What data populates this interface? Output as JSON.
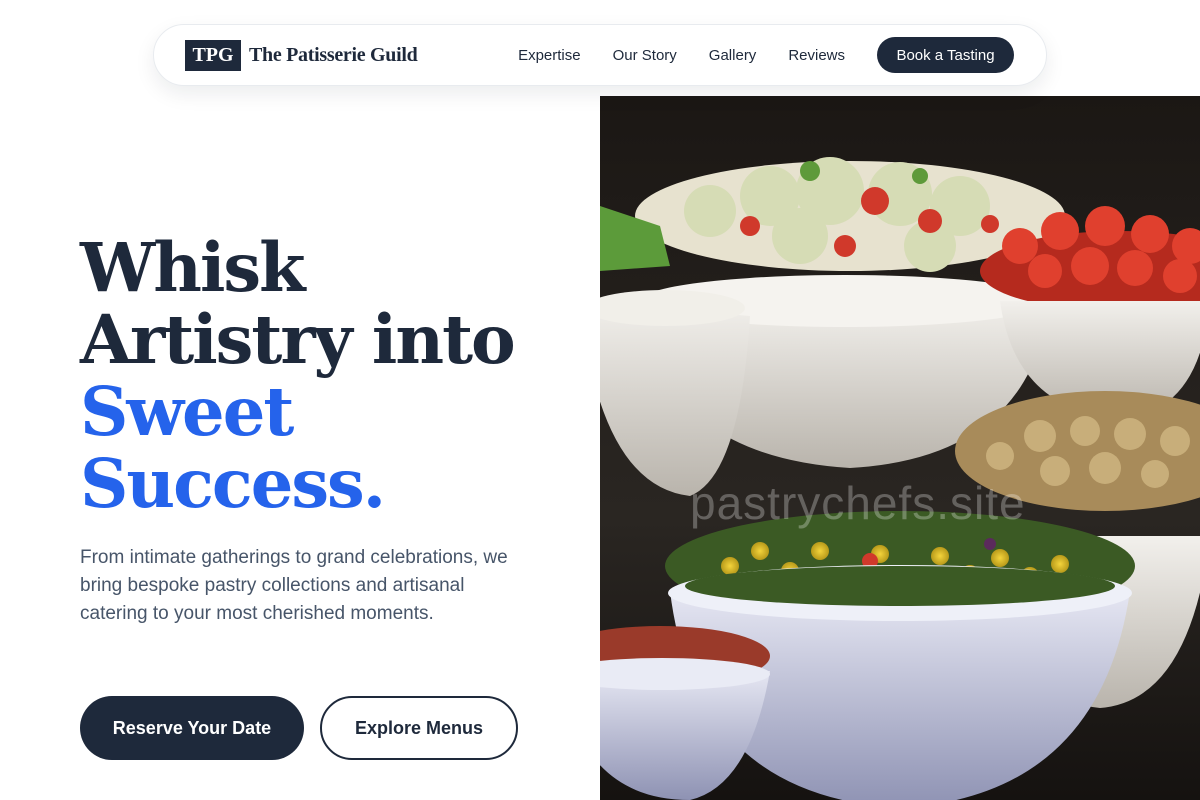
{
  "brand": {
    "mark": "TPG",
    "name": "The Patisserie Guild"
  },
  "nav": {
    "links": [
      "Expertise",
      "Our Story",
      "Gallery",
      "Reviews"
    ],
    "cta": "Book a Tasting"
  },
  "hero": {
    "title_lines": [
      "Whisk",
      "Artistry into"
    ],
    "title_accent_lines": [
      "Sweet",
      "Success."
    ],
    "subtitle": "From intimate gatherings to grand celebrations, we bring bespoke pastry collections and artisanal catering to your most cherished moments.",
    "primary_button": "Reserve Your Date",
    "secondary_button": "Explore Menus"
  },
  "image": {
    "watermark": "pastrychefs.site",
    "subject": "salad bowls on a buffet table"
  },
  "colors": {
    "navy": "#1e293b",
    "accent": "#2563eb",
    "muted": "#475569"
  }
}
